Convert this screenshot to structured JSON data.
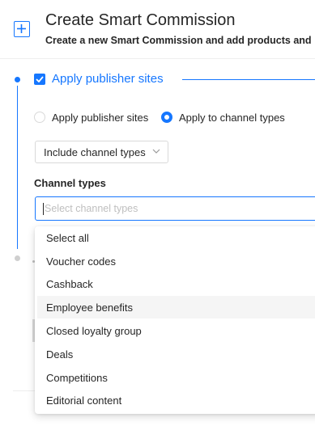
{
  "header": {
    "title": "Create Smart Commission",
    "subtitle": "Create a new Smart Commission and add products and"
  },
  "step": {
    "checkbox_label": "Apply publisher sites"
  },
  "apply_mode": {
    "options": [
      {
        "label": "Apply publisher sites",
        "selected": false
      },
      {
        "label": "Apply to channel types",
        "selected": true
      }
    ]
  },
  "include_select": {
    "value": "Include channel types"
  },
  "channel_types": {
    "label": "Channel types",
    "placeholder": "Select channel types",
    "options": [
      "Select all",
      "Voucher codes",
      "Cashback",
      "Employee benefits",
      "Closed loyalty group",
      "Deals",
      "Competitions",
      "Editorial content"
    ],
    "highlighted": "Employee benefits"
  },
  "colors": {
    "accent": "#1677ff",
    "text": "#262626",
    "placeholder": "#bfbfbf",
    "border": "#d9d9d9",
    "hover": "#f5f5f5"
  }
}
